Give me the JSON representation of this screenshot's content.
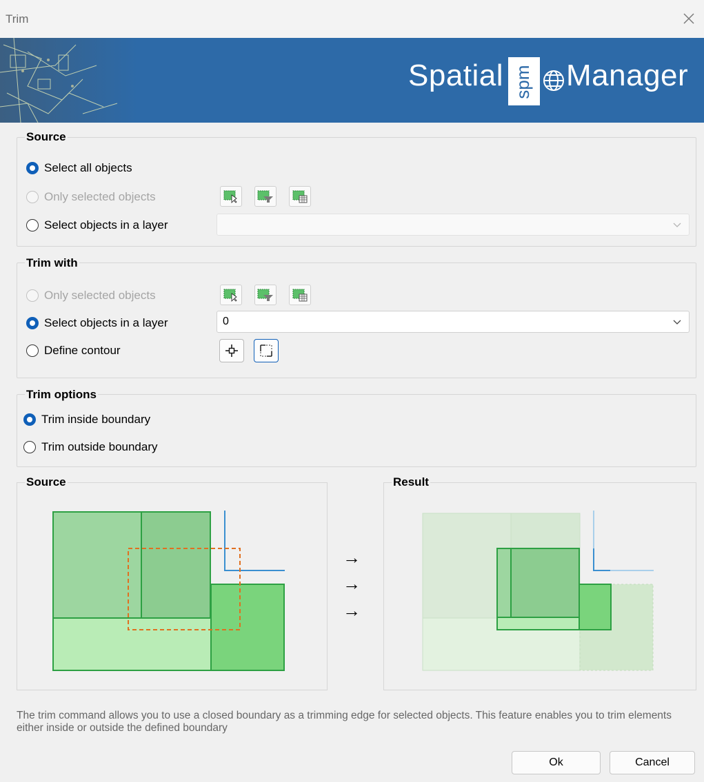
{
  "window": {
    "title": "Trim"
  },
  "banner": {
    "brand_left": "Spatial",
    "brand_logo": "spm",
    "brand_right": "Manager"
  },
  "source_group": {
    "title": "Source",
    "options": [
      {
        "label": "Select all objects",
        "checked": true,
        "enabled": true
      },
      {
        "label": "Only selected objects",
        "checked": false,
        "enabled": false
      },
      {
        "label": "Select objects in a layer",
        "checked": false,
        "enabled": true
      }
    ],
    "layer_value": ""
  },
  "trim_with_group": {
    "title": "Trim with",
    "options": [
      {
        "label": "Only selected objects",
        "checked": false,
        "enabled": false
      },
      {
        "label": "Select objects in a layer",
        "checked": true,
        "enabled": true
      },
      {
        "label": "Define contour",
        "checked": false,
        "enabled": true
      }
    ],
    "layer_value": "0"
  },
  "trim_options_group": {
    "title": "Trim options",
    "options": [
      {
        "label": "Trim inside boundary",
        "checked": true
      },
      {
        "label": "Trim outside boundary",
        "checked": false
      }
    ]
  },
  "preview": {
    "source_title": "Source",
    "result_title": "Result",
    "arrows": [
      "→",
      "→",
      "→"
    ]
  },
  "description": "The trim command allows you to use a closed boundary as a trimming edge for selected objects. This feature enables you to trim elements either inside or outside the defined boundary",
  "buttons": {
    "ok": "Ok",
    "cancel": "Cancel"
  },
  "icons": {
    "close": "close-icon",
    "select_pick": "select-objects-pick-icon",
    "select_filter": "select-objects-filter-icon",
    "select_table": "select-objects-table-icon",
    "point_pick": "crosshair-icon",
    "rect_pick": "rectangle-contour-icon",
    "dropdown": "chevron-down-icon"
  },
  "colors": {
    "banner": "#2d6aa8",
    "radio_checked": "#0f5fb8",
    "green_dark": "#2da043",
    "boundary": "#e07020",
    "line": "#3a8fd0"
  }
}
